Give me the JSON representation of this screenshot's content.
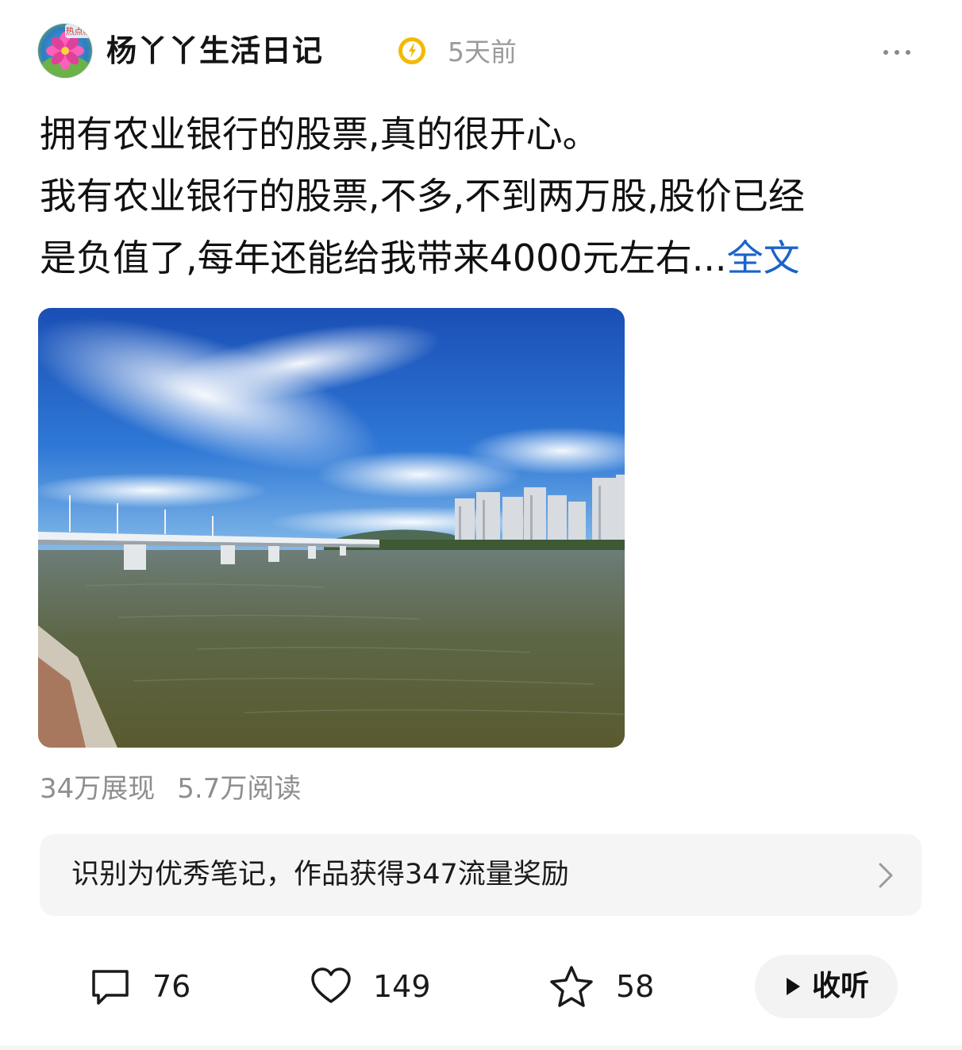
{
  "author": {
    "name": "杨丫丫生活日记",
    "avatar_badge_text": "热点榜",
    "verified_icon": "verified-badge-icon",
    "post_time": "5天前"
  },
  "post": {
    "lines": [
      "拥有农业银行的股票,真的很开心。",
      "我有农业银行的股票,不多,不到两万股,股价已经",
      "是负值了,每年还能给我带来4000元左右..."
    ],
    "full_text_label": "全文"
  },
  "stats": {
    "impressions": "34万展现",
    "reads": "5.7万阅读"
  },
  "reward_banner": {
    "text": "识别为优秀笔记，作品获得347流量奖励"
  },
  "actions": {
    "comments": "76",
    "likes": "149",
    "favorites": "58",
    "listen_label": "收听"
  },
  "colors": {
    "link": "#1a64c8",
    "badge": "#f5b800",
    "muted_text": "#9a9a9a"
  }
}
